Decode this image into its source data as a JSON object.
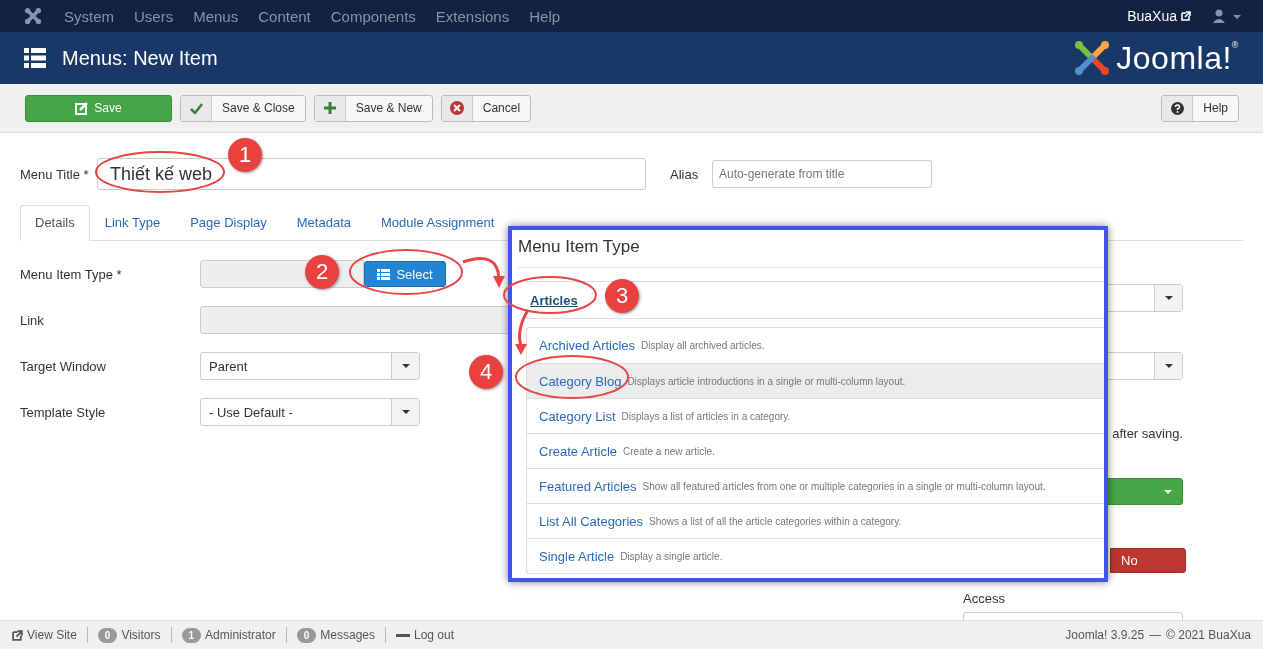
{
  "navbar": {
    "menu": [
      "System",
      "Users",
      "Menus",
      "Content",
      "Components",
      "Extensions",
      "Help"
    ],
    "user_link": "BuaXua"
  },
  "header": {
    "title": "Menus: New Item",
    "logo_text": "Joomla!$^{®}$"
  },
  "toolbar": {
    "buttons": [
      {
        "label": "Save",
        "kind": "save"
      },
      {
        "label": "Save & Close",
        "kind": "save-close"
      },
      {
        "label": "Save & New",
        "kind": "save-new"
      },
      {
        "label": "Cancel",
        "kind": "cancel"
      }
    ],
    "help": {
      "label": "Help",
      "kind": "help"
    }
  },
  "form": {
    "menu_title": {
      "label": "Menu Title *",
      "value": "Thiết kế web"
    },
    "alias": {
      "label": "Alias",
      "placeholder": "Auto-generate from title"
    },
    "tabs": [
      {
        "label": "Details",
        "selected": true
      },
      {
        "label": "Link Type",
        "selected": false
      },
      {
        "label": "Page Display",
        "selected": false
      },
      {
        "label": "Metadata",
        "selected": false
      },
      {
        "label": "Module Assignment",
        "selected": false
      }
    ],
    "fields": [
      {
        "label": "Menu Item Type *",
        "kind": "select-button",
        "button": "Select"
      },
      {
        "label": "Link",
        "kind": "readonly"
      },
      {
        "label": "Target Window",
        "kind": "dropdown",
        "value": "Parent"
      },
      {
        "label": "Template Style",
        "kind": "dropdown",
        "value": "- Use Default -"
      }
    ],
    "right_column": {
      "note": "after saving.",
      "toggle": "No",
      "access_label": "Access"
    }
  },
  "modal": {
    "title": "Menu Item Type",
    "group": "Articles",
    "items": [
      {
        "name": "Archived Articles",
        "description": "Display all archived articles.",
        "selected": false
      },
      {
        "name": "Category Blog",
        "description": "Displays article introductions in a single or multi-column layout.",
        "selected": true
      },
      {
        "name": "Category List",
        "description": "Displays a list of articles in a category.",
        "selected": false
      },
      {
        "name": "Create Article",
        "description": "Create a new article.",
        "selected": false
      },
      {
        "name": "Featured Articles",
        "description": "Show all featured articles from one or multiple categories in a single or multi-column layout.",
        "selected": false
      },
      {
        "name": "List All Categories",
        "description": "Shows a list of all the article categories within a category.",
        "selected": false
      },
      {
        "name": "Single Article",
        "description": "Display a single article.",
        "selected": false
      }
    ]
  },
  "annotations": [
    {
      "number": "1"
    },
    {
      "number": "2"
    },
    {
      "number": "3"
    },
    {
      "number": "4"
    }
  ],
  "status_bar": {
    "view_site": "View Site",
    "counters": [
      {
        "count": "0",
        "label": "Visitors"
      },
      {
        "count": "1",
        "label": "Administrator"
      },
      {
        "count": "0",
        "label": "Messages"
      }
    ],
    "logout": "Log out",
    "version": "Joomla! 3.9.25",
    "separator": "—",
    "copyright": "© 2021 BuaXua"
  }
}
